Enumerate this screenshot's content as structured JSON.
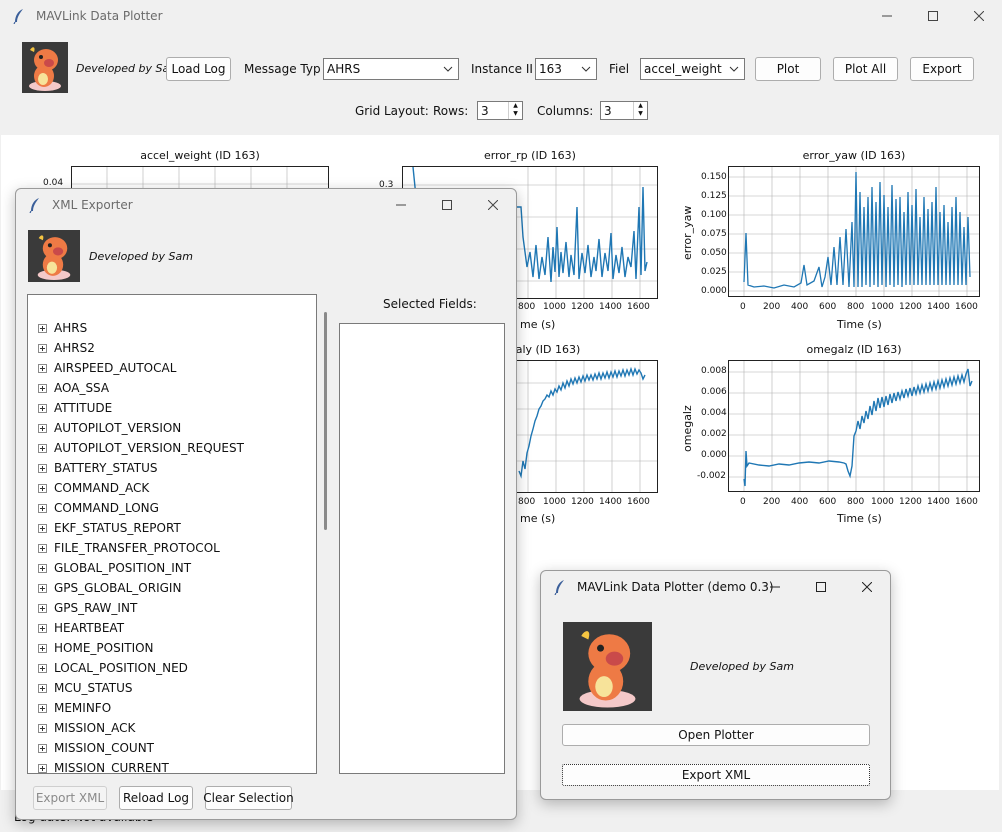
{
  "main": {
    "title": "MAVLink Data Plotter",
    "developer": "Developed by Sa",
    "load_log": "Load Log",
    "message_type_label": "Message Typ",
    "message_type_value": "AHRS",
    "instance_label": "Instance II",
    "instance_value": "163",
    "field_label": "Fiel",
    "field_value": "accel_weight",
    "plot": "Plot",
    "plot_all": "Plot All",
    "export": "Export",
    "grid_layout_label": "Grid Layout:",
    "rows_label": "Rows:",
    "rows_value": "3",
    "columns_label": "Columns:",
    "columns_value": "3",
    "status_text": "Log date: Not available"
  },
  "plots": [
    {
      "title": "accel_weight (ID 163)",
      "yticks": [
        "0.04"
      ],
      "xticks": [],
      "xlabel": "",
      "ylabel": ""
    },
    {
      "title": "error_rp (ID 163)",
      "yticks": [
        "0.3"
      ],
      "xticks": [
        "800",
        "1000",
        "1200",
        "1400",
        "1600"
      ],
      "xlabel": "me (s)",
      "ylabel": ""
    },
    {
      "title": "error_yaw (ID 163)",
      "yticks": [
        "0.150",
        "0.125",
        "0.100",
        "0.075",
        "0.050",
        "0.025",
        "0.000"
      ],
      "xticks": [
        "0",
        "200",
        "400",
        "600",
        "800",
        "1000",
        "1200",
        "1400",
        "1600"
      ],
      "xlabel": "Time (s)",
      "ylabel": "error_yaw"
    },
    {
      "title": "aly (ID 163)",
      "yticks": [],
      "xticks": [
        "800",
        "1000",
        "1200",
        "1400",
        "1600"
      ],
      "xlabel": "me (s)",
      "ylabel": ""
    },
    {
      "title": "omegalz (ID 163)",
      "yticks": [
        "0.008",
        "0.006",
        "0.004",
        "0.002",
        "0.000",
        "-0.002"
      ],
      "xticks": [
        "0",
        "200",
        "400",
        "600",
        "800",
        "1000",
        "1200",
        "1400",
        "1600"
      ],
      "xlabel": "Time (s)",
      "ylabel": "omegalz"
    }
  ],
  "xml": {
    "title": "XML Exporter",
    "developer": "Developed by Sam",
    "selected_fields": "Selected Fields:",
    "messages": [
      "AHRS",
      "AHRS2",
      "AIRSPEED_AUTOCAL",
      "AOA_SSA",
      "ATTITUDE",
      "AUTOPILOT_VERSION",
      "AUTOPILOT_VERSION_REQUEST",
      "BATTERY_STATUS",
      "COMMAND_ACK",
      "COMMAND_LONG",
      "EKF_STATUS_REPORT",
      "FILE_TRANSFER_PROTOCOL",
      "GLOBAL_POSITION_INT",
      "GPS_GLOBAL_ORIGIN",
      "GPS_RAW_INT",
      "HEARTBEAT",
      "HOME_POSITION",
      "LOCAL_POSITION_NED",
      "MCU_STATUS",
      "MEMINFO",
      "MISSION_ACK",
      "MISSION_COUNT",
      "MISSION_CURRENT"
    ],
    "export_xml": "Export XML",
    "reload_log": "Reload Log",
    "clear_selection": "Clear Selection"
  },
  "launcher": {
    "title": "MAVLink Data Plotter (demo 0.3)",
    "developer": "Developed by Sam",
    "open_plotter": "Open Plotter",
    "export_xml": "Export XML"
  },
  "colors": {
    "line": "#1f77b4",
    "grid": "#b0b0b0",
    "mascot_body": "#ee7a45",
    "mascot_bg": "#3a3a3a"
  }
}
